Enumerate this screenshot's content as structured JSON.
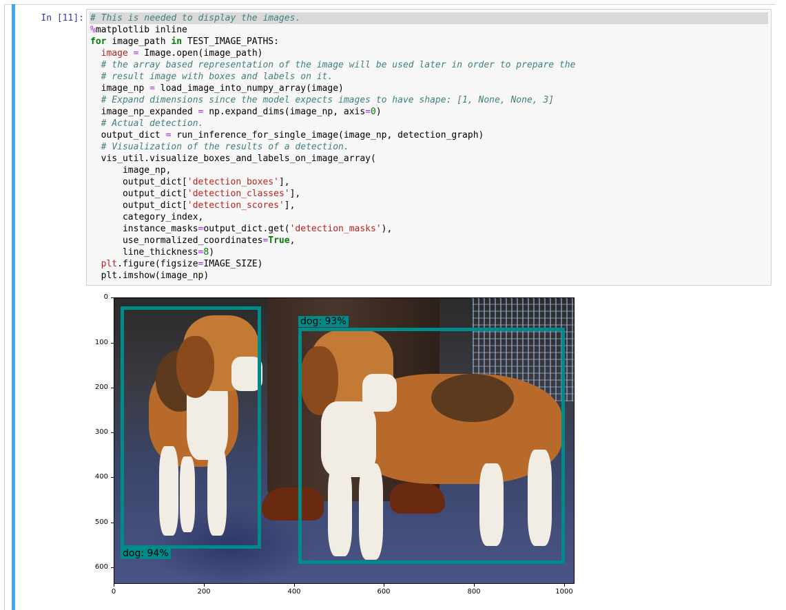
{
  "cell": {
    "prompt": "In [11]:",
    "code_lines": [
      [
        {
          "t": "cm",
          "s": "# This is needed to display the images."
        }
      ],
      [
        {
          "t": "mg",
          "s": "%"
        },
        {
          "t": "",
          "s": "matplotlib inline"
        }
      ],
      [
        {
          "t": "kw",
          "s": "for"
        },
        {
          "t": "",
          "s": " image_path "
        },
        {
          "t": "kw",
          "s": "in"
        },
        {
          "t": "",
          "s": " TEST_IMAGE_PATHS:"
        }
      ],
      [
        {
          "t": "",
          "s": "  "
        },
        {
          "t": "st",
          "s": "image"
        },
        {
          "t": "",
          "s": " "
        },
        {
          "t": "op",
          "s": "="
        },
        {
          "t": "",
          "s": " Image.open(image_path)"
        }
      ],
      [
        {
          "t": "",
          "s": "  "
        },
        {
          "t": "cm",
          "s": "# the array based representation of the image will be used later in order to prepare the"
        }
      ],
      [
        {
          "t": "",
          "s": "  "
        },
        {
          "t": "cm",
          "s": "# result image with boxes and labels on it."
        }
      ],
      [
        {
          "t": "",
          "s": "  image_np "
        },
        {
          "t": "op",
          "s": "="
        },
        {
          "t": "",
          "s": " load_image_into_numpy_array(image)"
        }
      ],
      [
        {
          "t": "",
          "s": "  "
        },
        {
          "t": "cm",
          "s": "# Expand dimensions since the model expects images to have shape: [1, None, None, 3]"
        }
      ],
      [
        {
          "t": "",
          "s": "  image_np_expanded "
        },
        {
          "t": "op",
          "s": "="
        },
        {
          "t": "",
          "s": " np.expand_dims(image_np, axis"
        },
        {
          "t": "op",
          "s": "="
        },
        {
          "t": "nu",
          "s": "0"
        },
        {
          "t": "",
          "s": ")"
        }
      ],
      [
        {
          "t": "",
          "s": "  "
        },
        {
          "t": "cm",
          "s": "# Actual detection."
        }
      ],
      [
        {
          "t": "",
          "s": "  output_dict "
        },
        {
          "t": "op",
          "s": "="
        },
        {
          "t": "",
          "s": " run_inference_for_single_image(image_np, detection_graph)"
        }
      ],
      [
        {
          "t": "",
          "s": "  "
        },
        {
          "t": "cm",
          "s": "# Visualization of the results of a detection."
        }
      ],
      [
        {
          "t": "",
          "s": "  vis_util.visualize_boxes_and_labels_on_image_array("
        }
      ],
      [
        {
          "t": "",
          "s": "      image_np,"
        }
      ],
      [
        {
          "t": "",
          "s": "      output_dict["
        },
        {
          "t": "st",
          "s": "'detection_boxes'"
        },
        {
          "t": "",
          "s": "],"
        }
      ],
      [
        {
          "t": "",
          "s": "      output_dict["
        },
        {
          "t": "st",
          "s": "'detection_classes'"
        },
        {
          "t": "",
          "s": "],"
        }
      ],
      [
        {
          "t": "",
          "s": "      output_dict["
        },
        {
          "t": "st",
          "s": "'detection_scores'"
        },
        {
          "t": "",
          "s": "],"
        }
      ],
      [
        {
          "t": "",
          "s": "      category_index,"
        }
      ],
      [
        {
          "t": "",
          "s": "      instance_masks"
        },
        {
          "t": "op",
          "s": "="
        },
        {
          "t": "",
          "s": "output_dict.get("
        },
        {
          "t": "st",
          "s": "'detection_masks'"
        },
        {
          "t": "",
          "s": "),"
        }
      ],
      [
        {
          "t": "",
          "s": "      use_normalized_coordinates"
        },
        {
          "t": "op",
          "s": "="
        },
        {
          "t": "kw",
          "s": "True"
        },
        {
          "t": "",
          "s": ","
        }
      ],
      [
        {
          "t": "",
          "s": "      line_thickness"
        },
        {
          "t": "op",
          "s": "="
        },
        {
          "t": "nu",
          "s": "8"
        },
        {
          "t": "",
          "s": ")"
        }
      ],
      [
        {
          "t": "",
          "s": "  "
        },
        {
          "t": "st",
          "s": "plt"
        },
        {
          "t": "",
          "s": ".figure(figsize"
        },
        {
          "t": "op",
          "s": "="
        },
        {
          "t": "",
          "s": "IMAGE_SIZE)"
        }
      ],
      [
        {
          "t": "",
          "s": "  plt.imshow(image_np)"
        }
      ]
    ]
  },
  "output": {
    "detections": [
      {
        "label": "dog: 94%",
        "name": "left-dog"
      },
      {
        "label": "dog: 93%",
        "name": "right-dog"
      }
    ],
    "y_ticks": [
      "0",
      "100",
      "200",
      "300",
      "400",
      "500",
      "600"
    ],
    "x_ticks": [
      "0",
      "200",
      "400",
      "600",
      "800",
      "1000"
    ]
  },
  "colors": {
    "cell_bar": "#42a5f5",
    "prompt": "#303f9f",
    "box": "#008b8b"
  }
}
